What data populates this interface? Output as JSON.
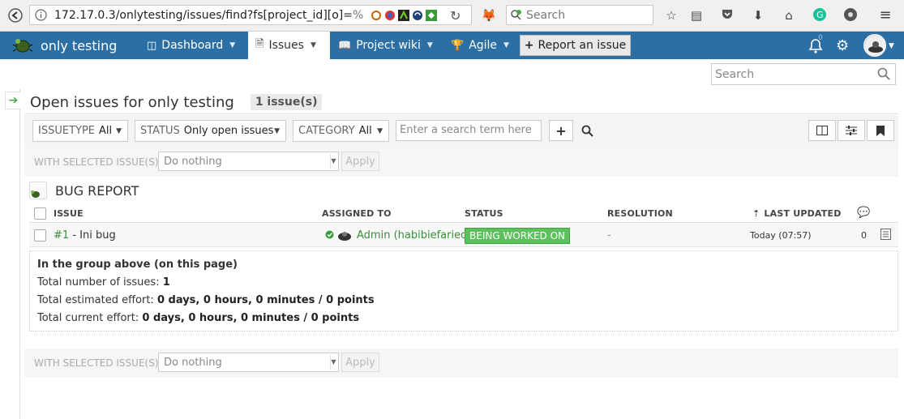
{
  "browser": {
    "url_main": "172.17.0.3/onlytesting/issues/find?fs[project_id][o]=",
    "url_tail": "%",
    "search_placeholder": "Search"
  },
  "nav": {
    "brand": "only testing",
    "items": [
      {
        "label": "Dashboard"
      },
      {
        "label": "Issues"
      },
      {
        "label": "Project wiki"
      },
      {
        "label": "Agile"
      }
    ],
    "report_button": "Report an issue",
    "notification_count": "0"
  },
  "page": {
    "search_placeholder": "Search",
    "title": "Open issues for only testing",
    "issue_count": "1 issue(s)"
  },
  "filters": {
    "issuetype": {
      "key": "ISSUETYPE",
      "value": "All"
    },
    "status": {
      "key": "STATUS",
      "value": "Only open issues"
    },
    "category": {
      "key": "CATEGORY",
      "value": "All"
    },
    "search_placeholder": "Enter a search term here"
  },
  "bulk": {
    "label": "WITH SELECTED ISSUE(S):",
    "action": "Do nothing",
    "apply": "Apply"
  },
  "group": {
    "title": "BUG REPORT",
    "columns": {
      "issue": "ISSUE",
      "assigned_to": "ASSIGNED TO",
      "status": "STATUS",
      "resolution": "RESOLUTION",
      "last_updated": "LAST UPDATED"
    },
    "rows": [
      {
        "issue_no": "#1",
        "issue_title": "- Ini bug",
        "assignee": "Admin (habibiefaried)",
        "status": "BEING WORKED ON",
        "resolution": "-",
        "last_updated": "Today (07:57)",
        "comments": "0"
      }
    ]
  },
  "summary": {
    "heading": "In the group above (on this page)",
    "total_issues_label": "Total number of issues:",
    "total_issues_value": "1",
    "estimated_label": "Total estimated effort:",
    "estimated_value": "0 days, 0 hours, 0 minutes / 0 points",
    "current_label": "Total current effort:",
    "current_value": "0 days, 0 hours, 0 minutes / 0 points"
  },
  "colors": {
    "nav_bg": "#2c6fa5",
    "status_green": "#5cc15c",
    "link_green": "#3a8d3a"
  }
}
